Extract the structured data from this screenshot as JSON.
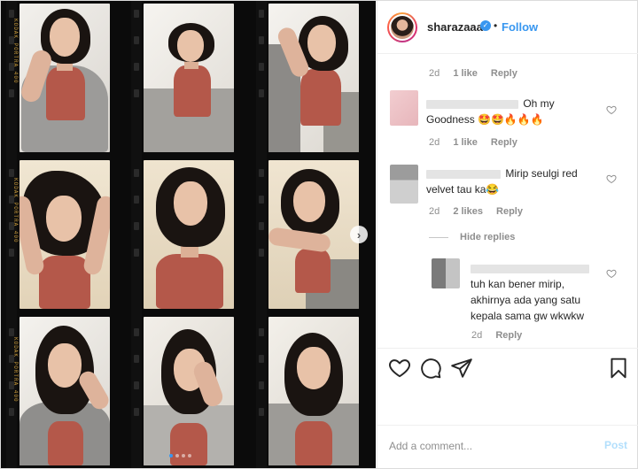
{
  "post": {
    "username": "sharazaaa",
    "separator": "•",
    "follow_label": "Follow",
    "film_edge_label": "KODAK PORTRA 400",
    "carousel_count": 4
  },
  "comments": [
    {
      "time": "2d",
      "likes": "1 like",
      "reply": "Reply"
    },
    {
      "text_line1": "Oh my",
      "text_line2": "Goodness 🤩🤩🔥🔥🔥",
      "time": "2d",
      "likes": "1 like",
      "reply": "Reply"
    },
    {
      "text_line1": "Mirip seulgi red",
      "text_line2": "velvet tau ka😂",
      "time": "2d",
      "likes": "2 likes",
      "reply": "Reply"
    }
  ],
  "hide_replies": "Hide replies",
  "reply_item": {
    "text_line1": "tuh kan bener mirip,",
    "text_line2": "akhirnya ada yang satu",
    "text_line3": "kepala sama gw wkwkw",
    "time": "2d",
    "reply": "Reply"
  },
  "add_comment": {
    "placeholder": "Add a comment...",
    "post_label": "Post"
  },
  "colors": {
    "accent": "#3897f0",
    "muted": "#8e8e8e",
    "text": "#262626",
    "post_disabled": "#b2dffc"
  },
  "icons": [
    "verified-badge-icon",
    "heart-icon",
    "comment-icon",
    "share-icon",
    "bookmark-icon",
    "chevron-right-icon"
  ]
}
